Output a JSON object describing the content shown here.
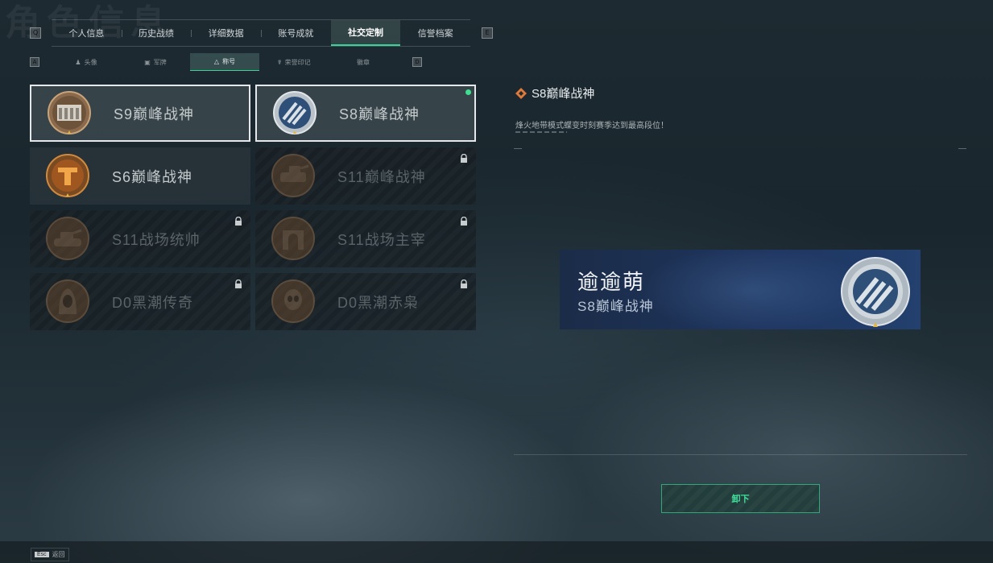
{
  "background_title": "角色信息",
  "top_nav": {
    "left_key": "Q",
    "right_key": "E",
    "tabs": [
      {
        "label": "个人信息",
        "active": false
      },
      {
        "label": "历史战绩",
        "active": false
      },
      {
        "label": "详细数据",
        "active": false
      },
      {
        "label": "账号成就",
        "active": false
      },
      {
        "label": "社交定制",
        "active": true
      },
      {
        "label": "信誉档案",
        "active": false
      }
    ]
  },
  "sub_nav": {
    "left_key": "A",
    "right_key": "D",
    "tabs": [
      {
        "label": "头像",
        "icon": "person-icon",
        "active": false
      },
      {
        "label": "军牌",
        "icon": "dogtag-icon",
        "active": false
      },
      {
        "label": "称号",
        "icon": "title-icon",
        "active": true
      },
      {
        "label": "荣誉印记",
        "icon": "emblem-icon",
        "active": false
      },
      {
        "label": "徽章",
        "icon": "",
        "active": false
      }
    ]
  },
  "titles": [
    {
      "name": "S9巅峰战神",
      "emblem": "s9-emblem-icon",
      "locked": false,
      "selected": true,
      "equipped": false
    },
    {
      "name": "S8巅峰战神",
      "emblem": "s8-emblem-icon",
      "locked": false,
      "selected": true,
      "equipped": true
    },
    {
      "name": "S6巅峰战神",
      "emblem": "s6-emblem-icon",
      "locked": false,
      "selected": false,
      "equipped": false
    },
    {
      "name": "S11巅峰战神",
      "emblem": "s11-peak-emblem-icon",
      "locked": true,
      "selected": false,
      "equipped": false
    },
    {
      "name": "S11战场统帅",
      "emblem": "s11-tank-emblem-icon",
      "locked": true,
      "selected": false,
      "equipped": false
    },
    {
      "name": "S11战场主宰",
      "emblem": "s11-arch-emblem-icon",
      "locked": true,
      "selected": false,
      "equipped": false
    },
    {
      "name": "D0黑潮传奇",
      "emblem": "d0-hood-emblem-icon",
      "locked": true,
      "selected": false,
      "equipped": false
    },
    {
      "name": "D0黑潮赤枭",
      "emblem": "d0-skull-emblem-icon",
      "locked": true,
      "selected": false,
      "equipped": false
    }
  ],
  "detail": {
    "title": "S8巅峰战神",
    "description": "烽火地带模式蝶变时刻赛季达到最高段位！"
  },
  "banner": {
    "player_name": "逾逾萌",
    "title": "S8巅峰战神"
  },
  "buttons": {
    "unequip": "卸下"
  },
  "footer": {
    "esc_key": "Esc",
    "esc_label": "返回"
  },
  "colors": {
    "accent_green": "#39d39a",
    "equipped_dot": "#3ee08f",
    "banner_blue": "#1e3560"
  }
}
